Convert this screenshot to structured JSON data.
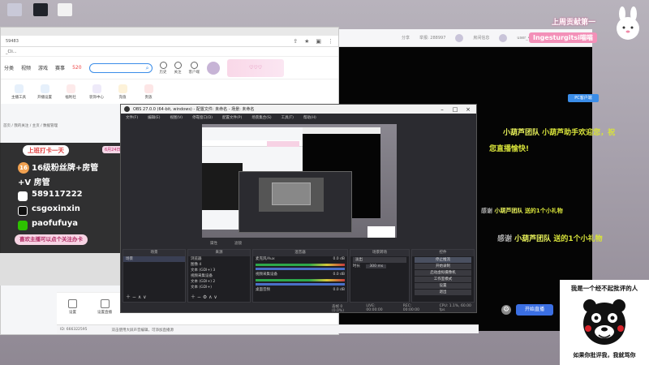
{
  "desktop": {
    "icons": [
      {
        "label": "",
        "color": "#c9c9d8"
      },
      {
        "label": "",
        "color": "#20232a"
      },
      {
        "label": "",
        "color": "#f2f2f2"
      }
    ]
  },
  "browser": {
    "address_partial": "59483",
    "bookmark": "_Cli...",
    "nav": [
      "分类",
      "视频",
      "游戏",
      "赛事",
      "520"
    ],
    "header_icons": [
      "历史",
      "关注",
      "客户端"
    ],
    "tools": [
      "主播工具",
      "开播设置",
      "福利社",
      "装饰中心",
      "充值",
      "贵族"
    ],
    "pc_client": "PC客户端",
    "crumb": "首页 / 我的关注 / 主页 / 数据管理",
    "note": "您可以下载客户端观看，获得更好的观看体验",
    "bottom_tools": [
      "设置",
      "设置直播"
    ],
    "status": [
      "ID: 666322595",
      "双击使用大屏声音编辑，可添加直播源"
    ]
  },
  "overlay": {
    "title": "上班打卡一天",
    "date": "6月24日",
    "lines": [
      {
        "badge": "16",
        "text": "16级粉丝牌+房管"
      },
      {
        "badge": "",
        "text": "+V 房管"
      },
      {
        "badge": "",
        "text": "589117222"
      },
      {
        "badge": "",
        "text": "csgoxinxin"
      },
      {
        "badge": "",
        "text": "paofufuya"
      }
    ],
    "follow": "喜欢主播可以点个关注办卡"
  },
  "obs": {
    "title": "OBS 27.0.0 (64-bit, windows) - 配置文件: 未命名 - 场景: 未命名",
    "menu": [
      "文件(F)",
      "编辑(E)",
      "视图(V)",
      "停靠窗口(D)",
      "配置文件(P)",
      "场景集合(S)",
      "工具(T)",
      "帮助(H)"
    ],
    "under_preview": [
      "属性",
      "滤镜"
    ],
    "docks": {
      "scenes_title": "场景",
      "scenes": [
        "场景"
      ],
      "sources_title": "来源",
      "sources": [
        "浏览器",
        "图像 4",
        "文本 (GDI+) 3",
        "视频采集设备",
        "文本 (GDI+) 2",
        "文本 (GDI+)"
      ],
      "mixer_title": "混音器",
      "mixer": [
        "麦克风/Aux",
        "视频采集设备",
        "桌面音频"
      ],
      "mixer_values": [
        "0.0 dB",
        "0.0 dB",
        "0.0 dB"
      ],
      "transitions_title": "场景转场",
      "transition_type": "淡出",
      "duration_label": "时长",
      "duration": "300 ms",
      "controls_title": "控件",
      "controls": [
        "停止推流",
        "开始录制",
        "启动虚拟摄像机",
        "工作室模式",
        "设置",
        "退出"
      ]
    },
    "status": [
      "丢帧 0 (0.0%)",
      "LIVE: 00:00:00",
      "REC: 00:00:00",
      "CPU: 1.1%, 60.00 fps"
    ]
  },
  "right_window": {
    "top": [
      "分享",
      "举报: 288997",
      "房间信息",
      "user_4"
    ],
    "danmaku": [
      {
        "name": "小葫芦团队",
        "text": "小葫芦助手欢迎您，祝"
      },
      {
        "name": "",
        "text": "您直播愉快!"
      },
      {
        "name": "小葫芦团队",
        "text": "送的1个小礼物"
      },
      {
        "name": "小葫芦团队",
        "text": "送的1个小礼物"
      }
    ],
    "go_live": "开始直播",
    "settings_icon": "gear-icon"
  },
  "cam_banner": {
    "line1": "上周贡献第一",
    "line2": "Ingesturgitsi喵喵"
  },
  "sticker": {
    "top": "我是一个经不起批评的人",
    "bottom": "如果你批评我，我就骂你"
  },
  "colors": {
    "obs_bg": "#2b2b30",
    "accent_blue": "#3b6fe3",
    "danmaku": "#d8e33a",
    "overlay_bg": "#141414"
  }
}
